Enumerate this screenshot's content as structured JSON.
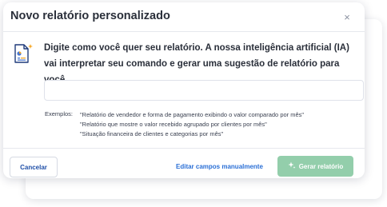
{
  "dialog": {
    "title": "Novo relatório personalizado",
    "close_label": "×",
    "instruction": "Digite como você quer seu relatório. A nossa inteligência artificial (IA) vai interpretar seu comando e gerar uma sugestão de relatório para você.",
    "input": {
      "value": "",
      "placeholder": ""
    },
    "examples_label": "Exemplos:",
    "examples": [
      "\"Relatório de vendedor e forma de pagamento exibindo o valor comparado por mês\"",
      "\"Relatório que mostre o valor recebido agrupado por clientes por mês\"",
      "\"Situação financeira de clientes e categorias por mês\""
    ]
  },
  "footer": {
    "cancel_label": "Cancelar",
    "edit_manual_label": "Editar campos manualmente",
    "generate_label": "Gerar relatório"
  },
  "icons": {
    "document": "document-chart-icon",
    "sparkle": "sparkle-icon",
    "close": "close-icon"
  },
  "colors": {
    "accent_blue": "#2a6fd6",
    "generate_button_disabled": "#93ceab",
    "sparkle_orange": "#f5a623"
  }
}
